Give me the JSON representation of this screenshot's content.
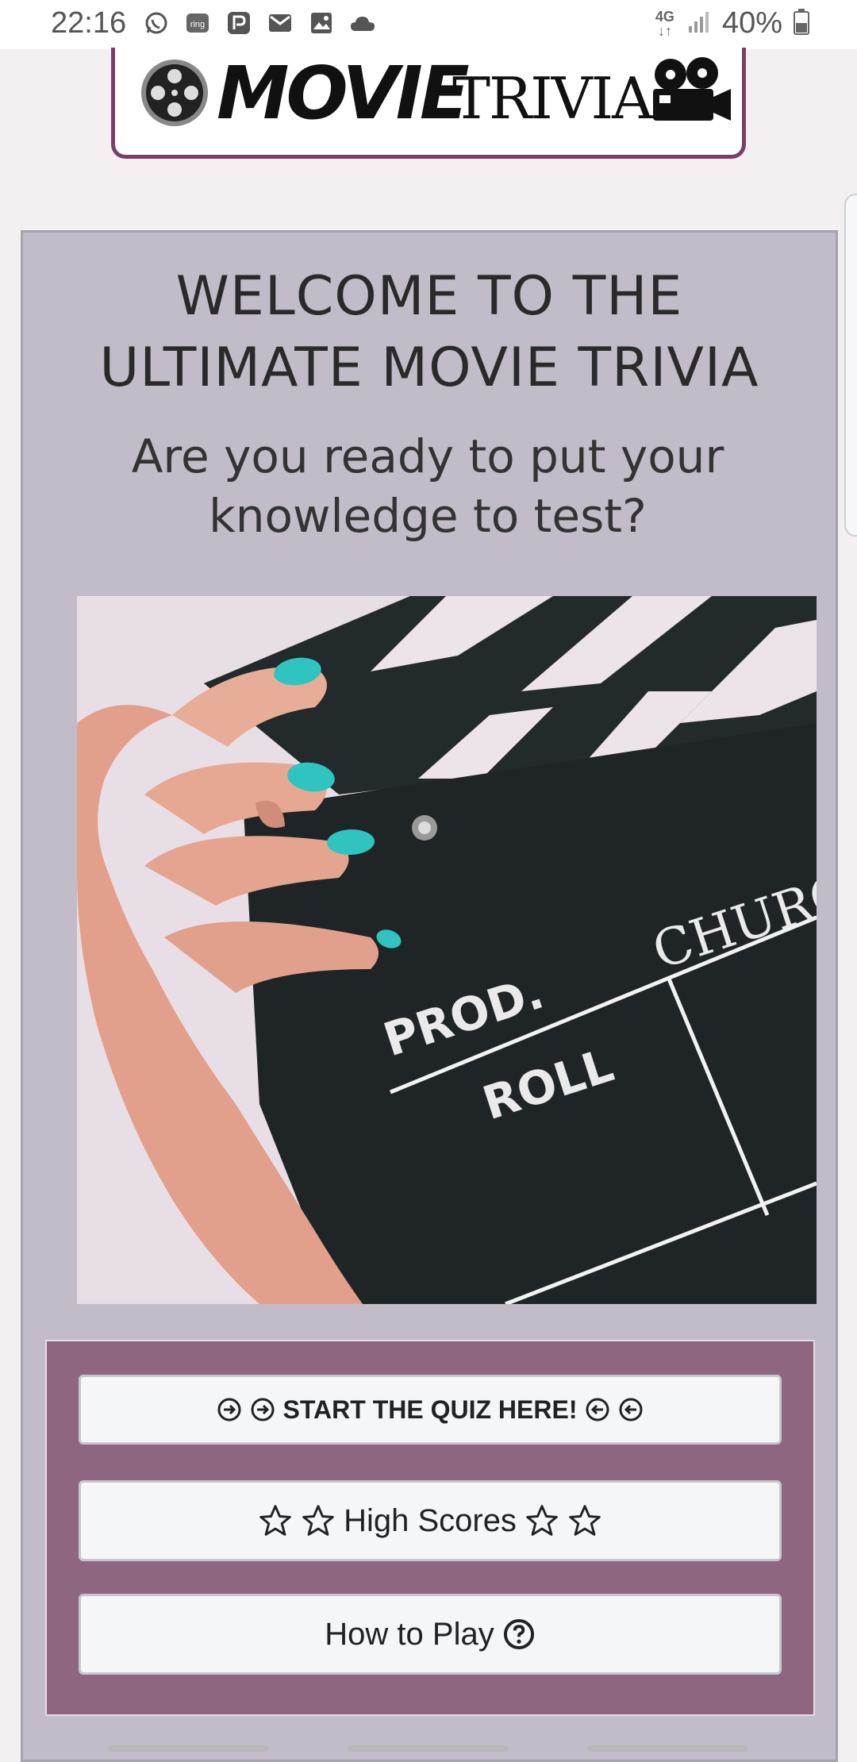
{
  "status_bar": {
    "time": "22:16",
    "network": "4G",
    "battery": "40%",
    "icons": [
      "whatsapp-icon",
      "ring-icon",
      "parking-app-icon",
      "mail-icon",
      "gallery-icon",
      "cloud-icon"
    ]
  },
  "logo": {
    "word1": "MOVIE",
    "word2": "TRIVIA"
  },
  "welcome": {
    "title_line1": "WELCOME TO THE",
    "title_line2": "ULTIMATE MOVIE TRIVIA",
    "subtitle_line1": "Are you ready to put your",
    "subtitle_line2": "knowledge to test?"
  },
  "hero": {
    "clapper_text_1": "PROD.",
    "clapper_text_2": "ROLL",
    "clapper_text_3": "CHURC"
  },
  "buttons": {
    "start_label": "START THE QUIZ HERE!",
    "high_scores_label": "High Scores",
    "how_to_play_label": "How to Play"
  },
  "colors": {
    "card_background": "#c2bcc8",
    "button_panel": "#8f6680",
    "logo_border": "#7a3f66",
    "nail_color": "#2fc4c0"
  }
}
